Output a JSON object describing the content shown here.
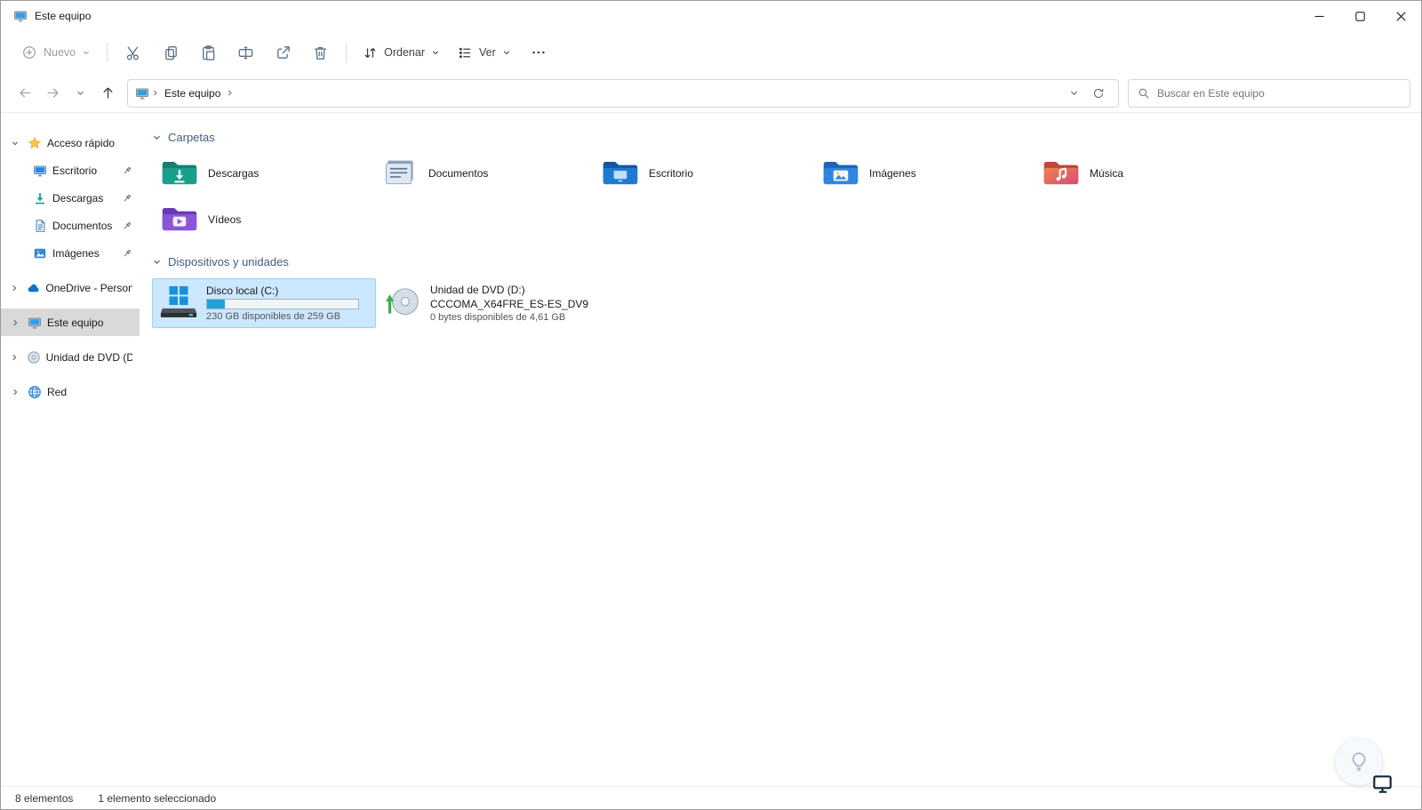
{
  "window": {
    "title": "Este equipo"
  },
  "toolbar": {
    "new_label": "Nuevo",
    "sort_label": "Ordenar",
    "view_label": "Ver"
  },
  "navigation": {
    "location": "Este equipo",
    "search_placeholder": "Buscar en Este equipo"
  },
  "sidebar": {
    "quick_access": {
      "label": "Acceso rápido",
      "items": [
        {
          "label": "Escritorio",
          "pinned": true
        },
        {
          "label": "Descargas",
          "pinned": true
        },
        {
          "label": "Documentos",
          "pinned": true
        },
        {
          "label": "Imágenes",
          "pinned": true
        }
      ]
    },
    "roots": [
      {
        "label": "OneDrive - Personal"
      },
      {
        "label": "Este equipo",
        "selected": true
      },
      {
        "label": "Unidad de DVD (D:)"
      },
      {
        "label": "Red"
      }
    ]
  },
  "content": {
    "folders_section": {
      "title": "Carpetas",
      "items": [
        {
          "label": "Descargas"
        },
        {
          "label": "Documentos"
        },
        {
          "label": "Escritorio"
        },
        {
          "label": "Imágenes"
        },
        {
          "label": "Música"
        },
        {
          "label": "Vídeos"
        }
      ]
    },
    "devices_section": {
      "title": "Dispositivos y unidades",
      "drives": [
        {
          "name": "Disco local (C:)",
          "free_space": "230 GB disponibles de 259 GB",
          "used_percent": 12,
          "selected": true
        },
        {
          "name": "Unidad de DVD (D:)",
          "volume_label": "CCCOMA_X64FRE_ES-ES_DV9",
          "free_space": "0 bytes disponibles de 4,61 GB"
        }
      ]
    }
  },
  "status_bar": {
    "items_count": "8 elementos",
    "selection_count": "1 elemento seleccionado"
  },
  "colors": {
    "selection_bg": "#cce8ff",
    "selection_border": "#99d1ff",
    "accent_blue": "#0078d4",
    "progress_fill": "#26a0da",
    "quick_access_star": "#f6c63e",
    "section_header_text": "#3f5e80",
    "sidebar_selected_bg": "#d9d9d9"
  }
}
